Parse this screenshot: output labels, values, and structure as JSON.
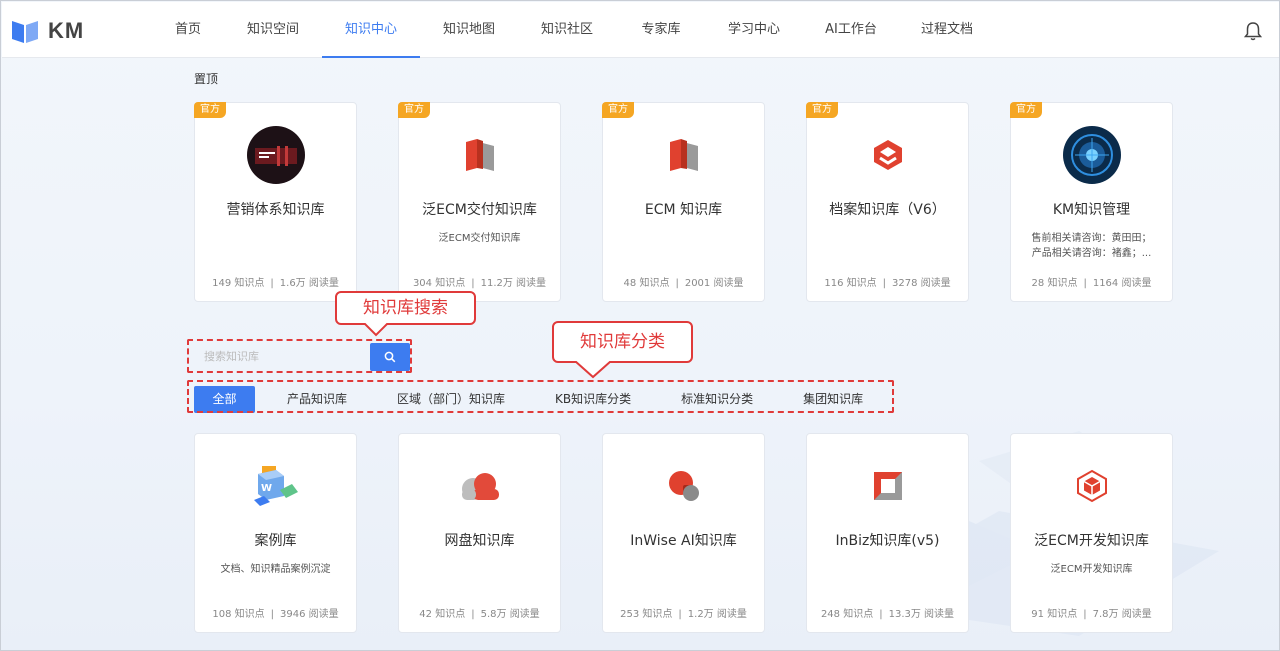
{
  "app": {
    "logo_text": "KM"
  },
  "nav": [
    {
      "label": "首页",
      "active": false
    },
    {
      "label": "知识空间",
      "active": false
    },
    {
      "label": "知识中心",
      "active": true
    },
    {
      "label": "知识地图",
      "active": false
    },
    {
      "label": "知识社区",
      "active": false
    },
    {
      "label": "专家库",
      "active": false
    },
    {
      "label": "学习中心",
      "active": false
    },
    {
      "label": "AI工作台",
      "active": false
    },
    {
      "label": "过程文档",
      "active": false
    }
  ],
  "pinned": {
    "label": "置顶",
    "cards": [
      {
        "badge": "官方",
        "title": "营销体系知识库",
        "desc": [],
        "points": "149",
        "points_unit": "知识点",
        "reads": "1.6万",
        "reads_unit": "阅读量",
        "icon": "marketing-photo-icon"
      },
      {
        "badge": "官方",
        "title": "泛ECM交付知识库",
        "desc": [
          "泛ECM交付知识库"
        ],
        "points": "304",
        "points_unit": "知识点",
        "reads": "11.2万",
        "reads_unit": "阅读量",
        "icon": "ecm-logo-icon"
      },
      {
        "badge": "官方",
        "title": "ECM 知识库",
        "desc": [],
        "points": "48",
        "points_unit": "知识点",
        "reads": "2001",
        "reads_unit": "阅读量",
        "icon": "ecm-logo-icon"
      },
      {
        "badge": "官方",
        "title": "档案知识库（V6）",
        "desc": [],
        "points": "116",
        "points_unit": "知识点",
        "reads": "3278",
        "reads_unit": "阅读量",
        "icon": "archive-logo-icon"
      },
      {
        "badge": "官方",
        "title": "KM知识管理",
        "desc": [
          "售前相关请咨询：黄田田；",
          "产品相关请咨询：褚鑫；..."
        ],
        "points": "28",
        "points_unit": "知识点",
        "reads": "1164",
        "reads_unit": "阅读量",
        "icon": "km-globe-icon"
      }
    ]
  },
  "search": {
    "placeholder": "搜索知识库"
  },
  "annotations": {
    "search_callout": "知识库搜索",
    "category_callout": "知识库分类"
  },
  "tabs": [
    {
      "label": "全部",
      "active": true
    },
    {
      "label": "产品知识库",
      "active": false
    },
    {
      "label": "区域（部门）知识库",
      "active": false
    },
    {
      "label": "KB知识库分类",
      "active": false
    },
    {
      "label": "标准知识分类",
      "active": false
    },
    {
      "label": "集团知识库",
      "active": false
    }
  ],
  "libraries": [
    {
      "title": "案例库",
      "desc": [
        "文档、知识精品案例沉淀"
      ],
      "points": "108",
      "points_unit": "知识点",
      "reads": "3946",
      "reads_unit": "阅读量",
      "icon": "case-library-icon"
    },
    {
      "title": "网盘知识库",
      "desc": [],
      "points": "42",
      "points_unit": "知识点",
      "reads": "5.8万",
      "reads_unit": "阅读量",
      "icon": "cloud-drive-icon"
    },
    {
      "title": "InWise AI知识库",
      "desc": [],
      "points": "253",
      "points_unit": "知识点",
      "reads": "1.2万",
      "reads_unit": "阅读量",
      "icon": "inwise-ai-icon"
    },
    {
      "title": "InBiz知识库(v5)",
      "desc": [],
      "points": "248",
      "points_unit": "知识点",
      "reads": "13.3万",
      "reads_unit": "阅读量",
      "icon": "inbiz-logo-icon"
    },
    {
      "title": "泛ECM开发知识库",
      "desc": [
        "泛ECM开发知识库"
      ],
      "points": "91",
      "points_unit": "知识点",
      "reads": "7.8万",
      "reads_unit": "阅读量",
      "icon": "ecm-dev-icon"
    }
  ],
  "colors": {
    "accent": "#3d7cf0",
    "badge": "#f5a623",
    "annotation": "#e03a3a"
  }
}
